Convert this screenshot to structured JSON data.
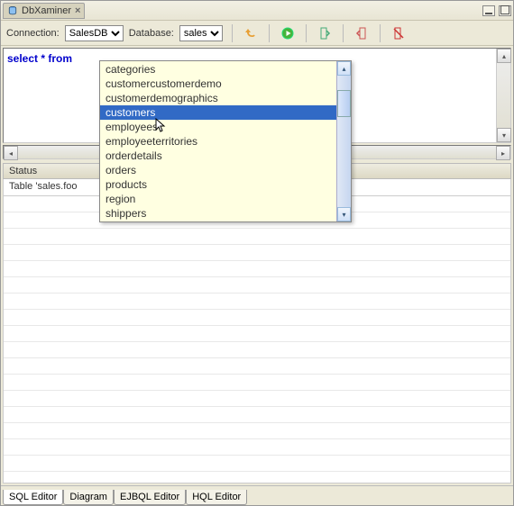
{
  "header": {
    "tab_title": "DbXaminer"
  },
  "toolbar": {
    "connection_label": "Connection:",
    "connection_value": "SalesDB",
    "database_label": "Database:",
    "database_value": "sales"
  },
  "editor": {
    "sql_text": "select * from "
  },
  "autocomplete": {
    "items": [
      "categories",
      "customercustomerdemo",
      "customerdemographics",
      "customers",
      "employees",
      "employeeterritories",
      "orderdetails",
      "orders",
      "products",
      "region",
      "shippers"
    ],
    "selected_index": 3
  },
  "status": {
    "header": "Status",
    "message": "Table 'sales.foo"
  },
  "bottom_tabs": {
    "items": [
      "SQL Editor",
      "Diagram",
      "EJBQL Editor",
      "HQL Editor"
    ],
    "active_index": 0
  }
}
